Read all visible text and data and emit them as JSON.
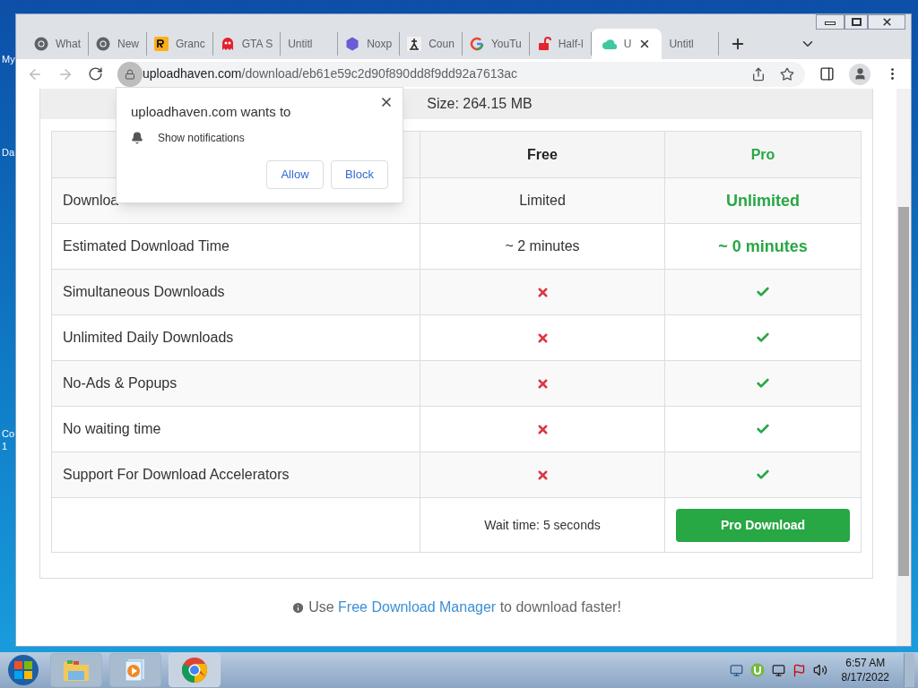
{
  "desktop": {
    "icon_labels": [
      "My",
      "Da",
      "Co",
      "1"
    ]
  },
  "browser": {
    "tabs": [
      {
        "title": "What",
        "kind": "chrome",
        "selected": false
      },
      {
        "title": "New",
        "kind": "chrome",
        "selected": false
      },
      {
        "title": "Granc",
        "kind": "rockstar",
        "selected": false
      },
      {
        "title": "GTA S",
        "kind": "ghost",
        "selected": false
      },
      {
        "title": "Untitl",
        "kind": "plain",
        "selected": false
      },
      {
        "title": "Noxp",
        "kind": "nox",
        "selected": false
      },
      {
        "title": "Coun",
        "kind": "runner",
        "selected": false
      },
      {
        "title": "YouTu",
        "kind": "google",
        "selected": false
      },
      {
        "title": "Half-l",
        "kind": "lock",
        "selected": false
      },
      {
        "title": "U",
        "kind": "cloud",
        "selected": true
      },
      {
        "title": "Untitl",
        "kind": "plain",
        "selected": false
      }
    ],
    "address": {
      "domain": "uploadhaven.com",
      "path": "/download/eb61e59c2d90f890dd8f9dd92a7613ac"
    }
  },
  "page": {
    "size_text": "Size: 264.15 MB",
    "table": {
      "columns": [
        "",
        "Free",
        "Pro"
      ],
      "rows": [
        {
          "feature": "Downloa",
          "free": {
            "kind": "text",
            "text": "Limited"
          },
          "pro": {
            "kind": "text",
            "text": "Unlimited"
          }
        },
        {
          "feature": "Estimated Download Time",
          "free": {
            "kind": "text",
            "text": "~ 2 minutes"
          },
          "pro": {
            "kind": "text",
            "text": "~ 0 minutes"
          }
        },
        {
          "feature": "Simultaneous Downloads",
          "free": {
            "kind": "cross"
          },
          "pro": {
            "kind": "check"
          }
        },
        {
          "feature": "Unlimited Daily Downloads",
          "free": {
            "kind": "cross"
          },
          "pro": {
            "kind": "check"
          }
        },
        {
          "feature": "No-Ads & Popups",
          "free": {
            "kind": "cross"
          },
          "pro": {
            "kind": "check"
          }
        },
        {
          "feature": "No waiting time",
          "free": {
            "kind": "cross"
          },
          "pro": {
            "kind": "check"
          }
        },
        {
          "feature": "Support For Download Accelerators",
          "free": {
            "kind": "cross"
          },
          "pro": {
            "kind": "check"
          }
        }
      ],
      "wait_text": "Wait time: 5 seconds",
      "pro_button": "Pro Download"
    },
    "footer": {
      "before": "Use",
      "link": "Free Download Manager",
      "after": "to download faster!"
    }
  },
  "popup": {
    "title": "uploadhaven.com wants to",
    "permission": "Show notifications",
    "buttons": [
      "Allow",
      "Block"
    ]
  },
  "taskbar": {
    "apps": [
      {
        "kind": "explorer",
        "selected": false
      },
      {
        "kind": "media",
        "selected": false
      },
      {
        "kind": "chrome",
        "selected": true
      }
    ],
    "time": "6:57 AM",
    "date": "8/17/2022"
  }
}
